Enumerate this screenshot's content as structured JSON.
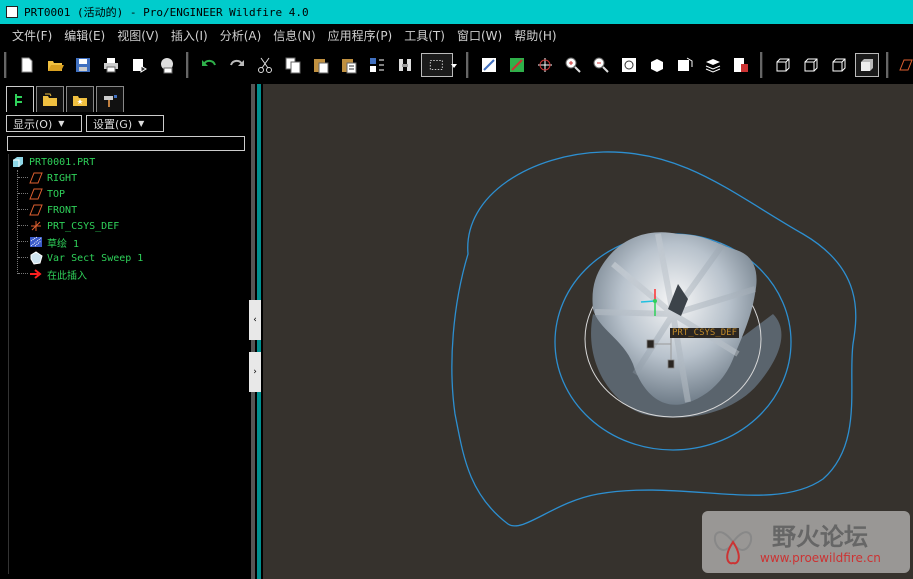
{
  "window": {
    "title": "PRT0001 (活动的) - Pro/ENGINEER Wildfire 4.0"
  },
  "menu": [
    "文件(F)",
    "编辑(E)",
    "视图(V)",
    "插入(I)",
    "分析(A)",
    "信息(N)",
    "应用程序(P)",
    "工具(T)",
    "窗口(W)",
    "帮助(H)"
  ],
  "toolbar_icons": [
    "new-icon",
    "open-icon",
    "save-icon",
    "print-icon",
    "send-icon",
    "email-icon",
    "undo-icon",
    "redo-icon",
    "cut-icon",
    "copy-icon",
    "paste-icon",
    "paste-special-icon",
    "regenerate-icon",
    "find-icon",
    "select-box-icon",
    "named-view-icon",
    "datum-toggle-icon",
    "spin-center-icon",
    "zoom-in-icon",
    "zoom-out-icon",
    "refit-icon",
    "reorient-icon",
    "saved-views-icon",
    "layers-icon",
    "view-manager-icon",
    "wireframe-icon",
    "hidden-line-icon",
    "no-hidden-icon",
    "shading-icon",
    "datum-plane-icon"
  ],
  "left_panel": {
    "tabs": [
      "model-tree-tab",
      "folder-browser-tab",
      "favorites-tab",
      "connections-tab"
    ],
    "display_button": "显示(O)",
    "settings_button": "设置(G)",
    "search_value": "",
    "tree": [
      {
        "label": "PRT0001.PRT",
        "icon": "part-icon"
      },
      {
        "label": "RIGHT",
        "icon": "datum-plane-icon"
      },
      {
        "label": "TOP",
        "icon": "datum-plane-icon"
      },
      {
        "label": "FRONT",
        "icon": "datum-plane-icon"
      },
      {
        "label": "PRT_CSYS_DEF",
        "icon": "csys-icon"
      },
      {
        "label": "草绘 1",
        "icon": "sketch-icon"
      },
      {
        "label": "Var Sect Sweep 1",
        "icon": "sweep-icon"
      },
      {
        "label": "在此插入",
        "icon": "insert-here-arrow-icon"
      }
    ]
  },
  "viewport": {
    "background": "#36322d",
    "csys_label": "PRT_CSYS_DEF",
    "curve_color": "#2d8fd0"
  },
  "watermark": {
    "title": "野火论坛",
    "url": "www.proewildfire.cn"
  }
}
